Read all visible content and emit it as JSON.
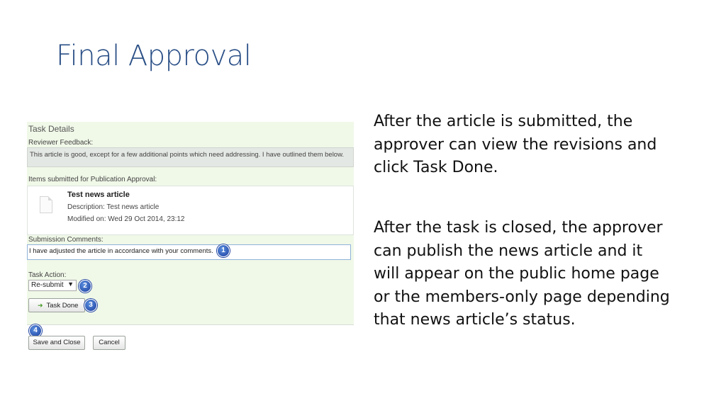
{
  "slide": {
    "title": "Final Approval",
    "paragraphs": [
      "After the article is submitted, the approver can view the revisions and click Task Done.",
      "After the task is closed, the approver can publish the news article and it will appear on the public home page or the members-only page depending that news article’s status."
    ]
  },
  "task": {
    "section_title": "Task Details",
    "feedback_label": "Reviewer Feedback:",
    "feedback_text": "This article is good, except for a few additional points which need addressing. I have outlined them below.",
    "items_label": "Items submitted for Publication Approval:",
    "item": {
      "icon": "document-icon",
      "title": "Test news article",
      "description": "Description: Test news article",
      "modified": "Modified on: Wed 29 Oct 2014, 23:12"
    },
    "comments_label": "Submission Comments:",
    "comments_value": "I have adjusted the article in accordance with your comments.",
    "action_label": "Task Action:",
    "action_selected": "Re-submit",
    "task_done_label": "Task Done",
    "save_close_label": "Save and Close",
    "cancel_label": "Cancel"
  },
  "badges": [
    "1",
    "2",
    "3",
    "4"
  ],
  "colors": {
    "title": "#2a4f86",
    "form_background": "#f0f8e8",
    "badge": "#1c3f9e"
  }
}
